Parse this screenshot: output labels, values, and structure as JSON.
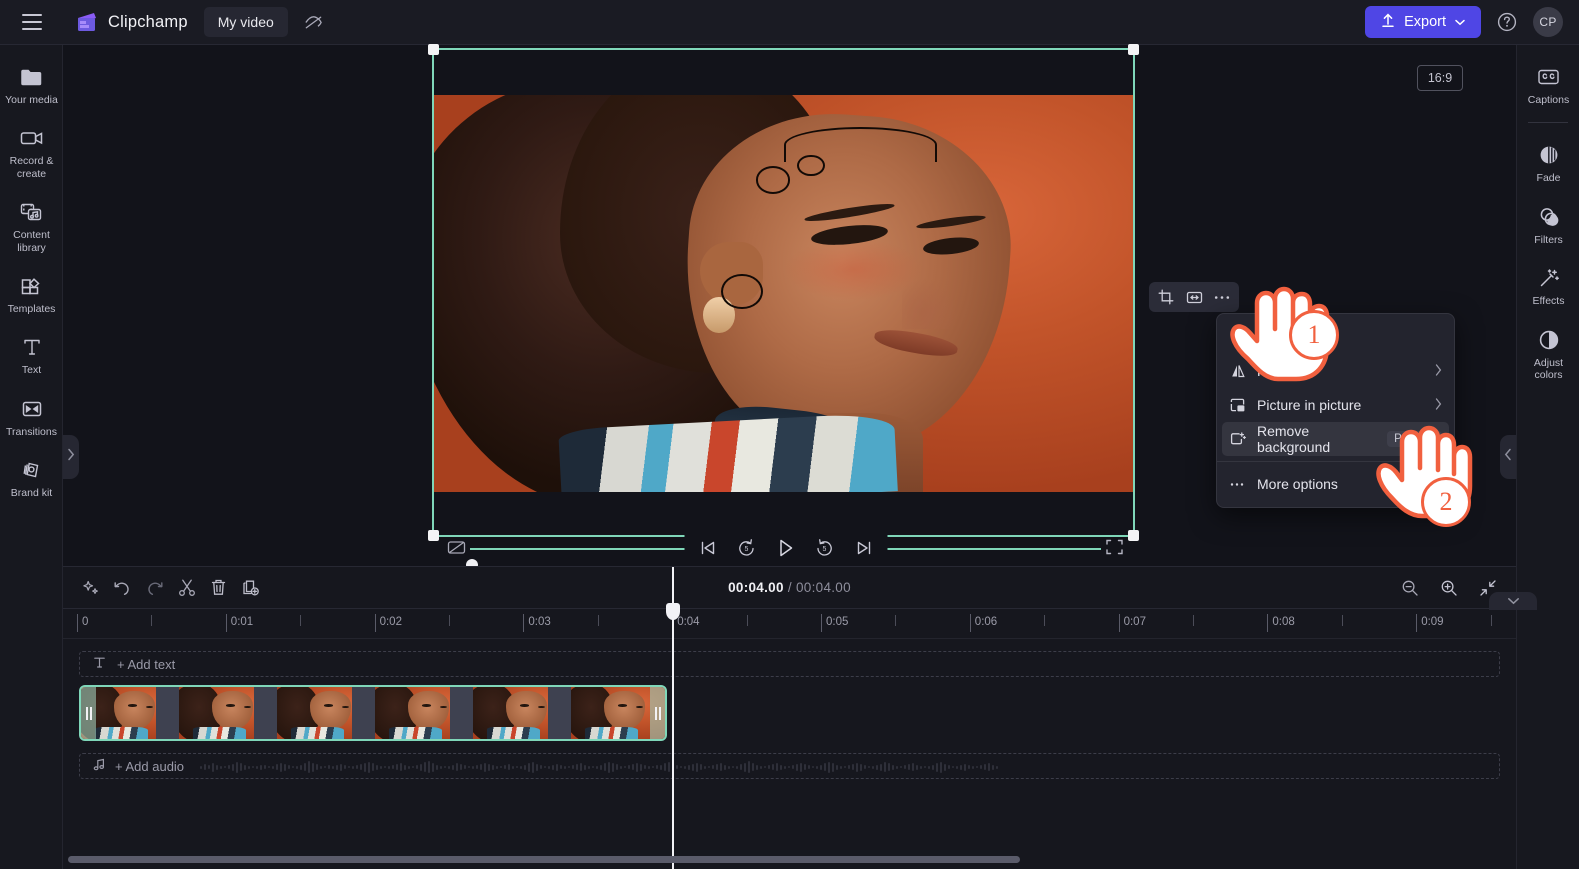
{
  "app": {
    "brand": "Clipchamp",
    "project_name": "My video"
  },
  "topbar": {
    "menu_icon": "hamburger-menu-icon",
    "logo_icon": "clipchamp-logo-icon",
    "eye_icon": "eye-off-icon",
    "export_label": "Export",
    "export_icon": "upload-icon",
    "export_chevron": "chevron-down-icon",
    "export_color": "#4F46E5",
    "help_icon": "help-circle-icon",
    "avatar_initials": "CP"
  },
  "left_rail": {
    "items": [
      {
        "label": "Your media",
        "icon": "folder-icon"
      },
      {
        "label": "Record & create",
        "icon": "video-camera-icon"
      },
      {
        "label": "Content library",
        "icon": "media-library-icon"
      },
      {
        "label": "Templates",
        "icon": "templates-grid-icon"
      },
      {
        "label": "Text",
        "icon": "text-t-icon"
      },
      {
        "label": "Transitions",
        "icon": "transitions-icon"
      },
      {
        "label": "Brand kit",
        "icon": "brand-kit-icon"
      }
    ],
    "expand_handle_icon": "chevron-right-icon"
  },
  "right_rail": {
    "items": [
      {
        "label": "Captions",
        "icon": "closed-captions-icon"
      },
      {
        "label": "Fade",
        "icon": "fade-icon"
      },
      {
        "label": "Filters",
        "icon": "filters-icon"
      },
      {
        "label": "Effects",
        "icon": "effects-wand-icon"
      },
      {
        "label": "Adjust colors",
        "icon": "adjust-colors-icon"
      }
    ],
    "collapse_handle_icon": "chevron-left-icon"
  },
  "stage": {
    "aspect_ratio": "16:9",
    "selection_color": "#7FD7B9",
    "background_color": "#C2542A",
    "float_toolbar": [
      {
        "name": "crop",
        "icon": "crop-icon"
      },
      {
        "name": "fit",
        "icon": "fit-resize-icon"
      },
      {
        "name": "more",
        "icon": "ellipsis-icon"
      }
    ],
    "collapse_down_icon": "chevron-down-icon"
  },
  "context_menu": {
    "items": [
      {
        "label": "",
        "icon": "rotate-icon",
        "submenu": false,
        "badge": "",
        "active": false
      },
      {
        "label": "Flip",
        "icon": "flip-icon",
        "submenu": true,
        "badge": "",
        "active": false
      },
      {
        "label": "Picture in picture",
        "icon": "picture-in-picture-icon",
        "submenu": true,
        "badge": "",
        "active": false
      },
      {
        "label": "Remove background",
        "icon": "remove-background-icon",
        "submenu": false,
        "badge": "Preview",
        "active": true
      },
      {
        "label": "More options",
        "icon": "ellipsis-icon",
        "submenu": false,
        "badge": "",
        "active": false
      }
    ]
  },
  "player": {
    "mute_icon": "mute-icon",
    "skip_start_icon": "skip-to-start-icon",
    "rewind_icon": "rewind-5-icon",
    "play_icon": "play-icon",
    "forward_icon": "forward-5-icon",
    "skip_end_icon": "skip-to-end-icon",
    "fullscreen_icon": "fullscreen-icon",
    "progress_color": "#7FD7B9"
  },
  "timeline": {
    "toolbar_left": [
      {
        "name": "magic",
        "icon": "sparkle-magic-icon"
      },
      {
        "name": "undo",
        "icon": "undo-icon"
      },
      {
        "name": "redo",
        "icon": "redo-icon"
      },
      {
        "name": "split",
        "icon": "scissors-split-icon"
      },
      {
        "name": "delete",
        "icon": "trash-delete-icon"
      },
      {
        "name": "duplicate",
        "icon": "duplicate-icon"
      }
    ],
    "toolbar_right": [
      {
        "name": "zoom-out",
        "icon": "zoom-out-icon"
      },
      {
        "name": "zoom-in",
        "icon": "zoom-in-icon"
      },
      {
        "name": "fit-timeline",
        "icon": "fit-to-screen-icon"
      }
    ],
    "current_time": "00:04.00",
    "total_time": "00:04.00",
    "time_separator": "/",
    "ruler_labels": [
      "0",
      "0:01",
      "0:02",
      "0:03",
      "0:04",
      "0:05",
      "0:06",
      "0:07",
      "0:08",
      "0:09"
    ],
    "text_track_label": "+ Add text",
    "text_track_icon": "text-t-icon",
    "audio_track_label": "+ Add audio",
    "audio_track_icon": "music-note-icon",
    "playhead_time": "0:04"
  },
  "annotations": {
    "steps": [
      {
        "number": "1",
        "target": "more-options-toolbar-button"
      },
      {
        "number": "2",
        "target": "remove-background-menu-item"
      }
    ],
    "accent_color": "#F1603F"
  }
}
